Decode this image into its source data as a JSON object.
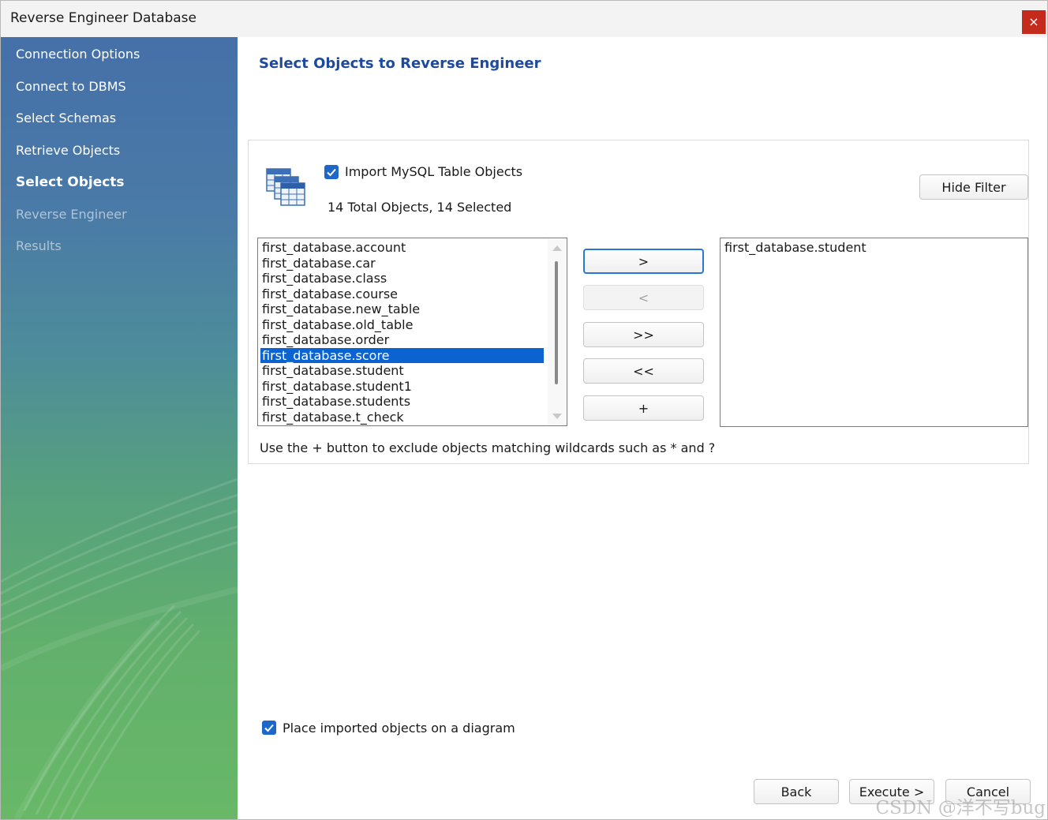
{
  "window": {
    "title": "Reverse Engineer Database",
    "close_glyph": "×"
  },
  "sidebar": {
    "items": [
      {
        "label": "Connection Options",
        "state": "done"
      },
      {
        "label": "Connect to DBMS",
        "state": "done"
      },
      {
        "label": "Select Schemas",
        "state": "done"
      },
      {
        "label": "Retrieve Objects",
        "state": "done"
      },
      {
        "label": "Select Objects",
        "state": "active"
      },
      {
        "label": "Reverse Engineer",
        "state": "disabled"
      },
      {
        "label": "Results",
        "state": "disabled"
      }
    ]
  },
  "main": {
    "heading": "Select Objects to Reverse Engineer",
    "import_checkbox": {
      "label": "Import MySQL Table Objects",
      "checked": true
    },
    "summary": "14 Total Objects, 14 Selected",
    "hide_filter_label": "Hide Filter",
    "available_list": [
      "first_database.account",
      "first_database.car",
      "first_database.class",
      "first_database.course",
      "first_database.new_table",
      "first_database.old_table",
      "first_database.order",
      "first_database.score",
      "first_database.student",
      "first_database.student1",
      "first_database.students",
      "first_database.t_check"
    ],
    "selected_index": 7,
    "excluded_list": [
      "first_database.student"
    ],
    "buttons": {
      "move_right": ">",
      "move_left": "<",
      "move_all_right": ">>",
      "move_all_left": "<<",
      "add_wildcard": "+"
    },
    "hint": "Use the + button to exclude objects matching wildcards such as * and ?",
    "diagram_checkbox": {
      "label": "Place imported objects on a diagram",
      "checked": true
    }
  },
  "footer": {
    "back_label": "Back",
    "execute_label": "Execute >",
    "cancel_label": "Cancel"
  },
  "watermark": "CSDN @洋不写bug",
  "colors": {
    "heading": "#1d4a9c",
    "selection": "#0a63d1",
    "checkbox": "#1c67c9",
    "close": "#c42b1c"
  }
}
